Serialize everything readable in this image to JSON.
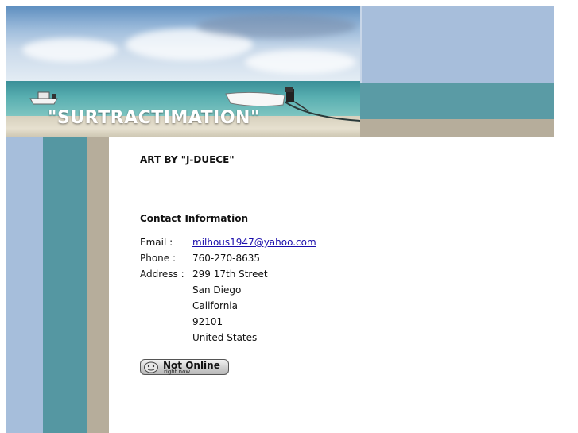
{
  "header": {
    "title": "\"SURTRACTIMATION\""
  },
  "main": {
    "art_by": "ART BY \"J-DUECE\"",
    "contact_heading": "Contact Information",
    "contact": {
      "email_label": "Email :",
      "email_value": "milhous1947@yahoo.com",
      "phone_label": "Phone :",
      "phone_value": "760-270-8635",
      "address_label": "Address :",
      "address_lines": [
        "299 17th Street",
        "San Diego",
        "California",
        "92101",
        "United States"
      ]
    },
    "status_badge": {
      "main": "Not Online",
      "sub": "right now"
    }
  },
  "colors": {
    "stripe_blue": "#a6bedb",
    "stripe_teal": "#5597a2",
    "stripe_tan": "#b6ad9b",
    "link": "#1a0dab"
  }
}
